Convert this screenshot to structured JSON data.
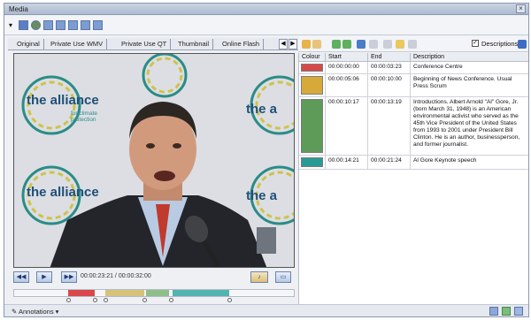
{
  "window": {
    "title": "Media"
  },
  "tabs": [
    {
      "label": "Original"
    },
    {
      "label": "Private Use WMV"
    },
    {
      "label": "Private Use QT"
    },
    {
      "label": "Thumbnail"
    },
    {
      "label": "Online Flash"
    }
  ],
  "video": {
    "backdrop_text": "the alliance",
    "backdrop_sub_1": "for climate",
    "backdrop_sub_2": "protection"
  },
  "player": {
    "timecode": "00:00:23:21 / 00:00:32:00"
  },
  "descriptions_toggle": {
    "label": "Descriptions",
    "checked": true
  },
  "table": {
    "columns": [
      "Colour",
      "Start",
      "End",
      "Description"
    ],
    "rows": [
      {
        "colour": "#d9474a",
        "start": "00:00:00:00",
        "end": "00:00:03:23",
        "description": "Conference Centre"
      },
      {
        "colour": "#d6a93a",
        "start": "00:00:05:06",
        "end": "00:00:10:00",
        "description": "Beginning of News Conference. Usual Press Scrum"
      },
      {
        "colour": "#5e9a58",
        "start": "00:00:10:17",
        "end": "00:00:13:19",
        "description": "Introductions. Albert Arnold \"Al\" Gore, Jr. (born March 31, 1948) is an American environmental activist who served as the 45th Vice President of the United States from 1993 to 2001 under President Bill Clinton. He is an author, businessperson, and former journalist."
      },
      {
        "colour": "#2a9a96",
        "start": "00:00:14:21",
        "end": "00:00:21:24",
        "description": "Al Gore Keynote speech"
      }
    ]
  },
  "bottom": {
    "annotations_label": "Annotations"
  }
}
